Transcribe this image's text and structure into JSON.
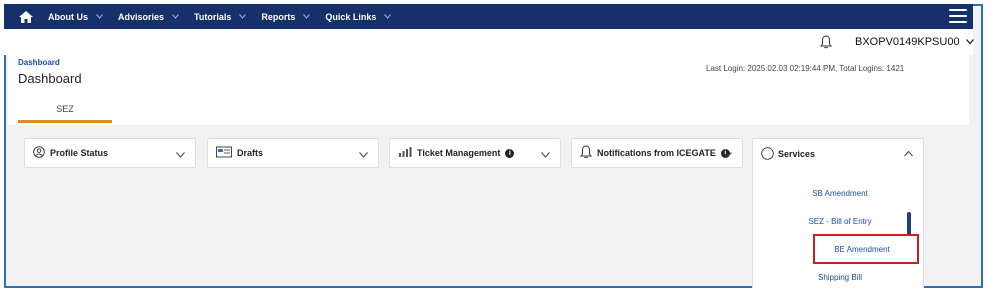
{
  "nav": {
    "items": [
      "About Us",
      "Advisories",
      "Tutorials",
      "Reports",
      "Quick Links"
    ]
  },
  "user": {
    "id": "BXOPV0149KPSU00"
  },
  "header": {
    "breadcrumb": "Dashboard",
    "title": "Dashboard",
    "last_login": "Last Login: 2025.02.03 02:19:44 PM, Total Logins: 1421",
    "tab": "SEZ"
  },
  "cards": {
    "profile_status": "Profile Status",
    "drafts": "Drafts",
    "ticket_management": "Ticket Management",
    "notifications": "Notifications from ICEGATE",
    "services": "Services"
  },
  "services_menu": [
    "SB Amendment",
    "SEZ - Bill of Entry",
    "BE Amendment",
    "Shipping Bill"
  ],
  "colors": {
    "nav_bg": "#16306a",
    "tab_underline": "#e08a1e",
    "link": "#1d4fa0",
    "highlight": "#cc2020",
    "frame_border": "#2f6fb3"
  }
}
